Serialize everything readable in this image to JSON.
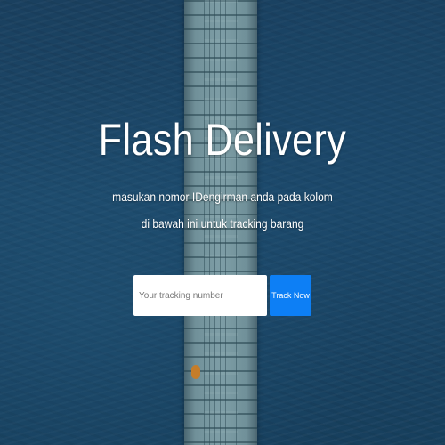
{
  "hero": {
    "title": "Flash Delivery",
    "subtitle_line1": "masukan nomor IDengirman anda pada kolom",
    "subtitle_line2": "di bawah ini untuk tracking barang"
  },
  "tracking_form": {
    "input_placeholder": "Your tracking number",
    "input_value": "",
    "button_label": "Track Now"
  },
  "colors": {
    "sea_background": "#1d4566",
    "button_accent": "#0d7ff5",
    "text": "#ffffff"
  }
}
